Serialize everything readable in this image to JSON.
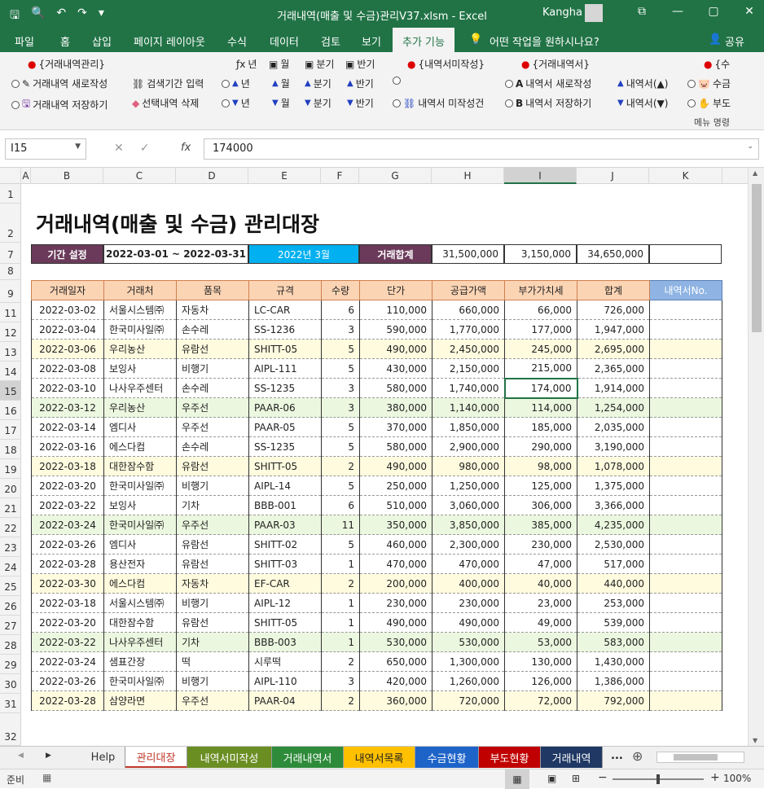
{
  "window": {
    "title": "거래내역(매출 및 수금)관리V37.xlsm  -  Excel",
    "user": "Kangha",
    "min_icon": "—",
    "restore_icon": "▢",
    "close_icon": "✕",
    "ribbon_display_icon": "⧉"
  },
  "menu": {
    "tabs": [
      "파일",
      "홈",
      "삽입",
      "페이지 레이아웃",
      "수식",
      "데이터",
      "검토",
      "보기",
      "추가 기능"
    ],
    "active_tab": "추가 기능",
    "tell_me": "어떤 작업을 원하시나요?",
    "share": "공유"
  },
  "ribbon": {
    "g1_header": "{거래내역관리}",
    "new_entry": "거래내역 새로작성",
    "save_entry": "거래내역 저장하기",
    "search_period": "검색기간 입력",
    "delete_sel": "선택내역 삭제",
    "year": "년",
    "month": "월",
    "quarter": "분기",
    "half": "반기",
    "g2_header": "{내역서미작성}",
    "unwritten_cond": "내역서 미작성건",
    "g3_header": "{거래내역서}",
    "stmt_new": "내역서 새로작성",
    "stmt_save": "내역서 저장하기",
    "stmt_up": "내역서(▲)",
    "stmt_down": "내역서(▼)",
    "g4_header": "{수",
    "g4_item1": "수금",
    "g4_item2": "부도",
    "caption": "메뉴 명령"
  },
  "formula": {
    "cell_ref": "I15",
    "value": "174000",
    "fx": "fx"
  },
  "columns": [
    "A",
    "B",
    "C",
    "D",
    "E",
    "F",
    "G",
    "H",
    "I",
    "J",
    "K"
  ],
  "rows": [
    "1",
    "2",
    "7",
    "8",
    "9",
    "11",
    "12",
    "13",
    "14",
    "15",
    "16",
    "17",
    "18",
    "19",
    "20",
    "21",
    "22",
    "23",
    "24",
    "25",
    "26",
    "27",
    "28",
    "29",
    "30",
    "31",
    "32"
  ],
  "sheet": {
    "title": "거래내역(매출 및 수금) 관리대장",
    "period_label": "기간 설정",
    "period_range": "2022-03-01 ~ 2022-03-31",
    "month_label": "2022년 3월",
    "total_label": "거래합계",
    "total_supply": "31,500,000",
    "total_vat": "3,150,000",
    "total_sum": "34,650,000",
    "headers": [
      "거래일자",
      "거래처",
      "품목",
      "규격",
      "수량",
      "단가",
      "공급가액",
      "부가가치세",
      "합계",
      "내역서No."
    ],
    "rows": [
      [
        "2022-03-02",
        "서울시스템㈜",
        "자동차",
        "LC-CAR",
        "6",
        "110,000",
        "660,000",
        "66,000",
        "726,000",
        ""
      ],
      [
        "2022-03-04",
        "한국미사일㈜",
        "손수레",
        "SS-1236",
        "3",
        "590,000",
        "1,770,000",
        "177,000",
        "1,947,000",
        ""
      ],
      [
        "2022-03-06",
        "우리농산",
        "유람선",
        "SHITT-05",
        "5",
        "490,000",
        "2,450,000",
        "245,000",
        "2,695,000",
        ""
      ],
      [
        "2022-03-08",
        "보잉사",
        "비행기",
        "AIPL-111",
        "5",
        "430,000",
        "2,150,000",
        "215,000",
        "2,365,000",
        ""
      ],
      [
        "2022-03-10",
        "나사우주센터",
        "손수레",
        "SS-1235",
        "3",
        "580,000",
        "1,740,000",
        "174,000",
        "1,914,000",
        ""
      ],
      [
        "2022-03-12",
        "우리농산",
        "우주선",
        "PAAR-06",
        "3",
        "380,000",
        "1,140,000",
        "114,000",
        "1,254,000",
        ""
      ],
      [
        "2022-03-14",
        "엠디사",
        "우주선",
        "PAAR-05",
        "5",
        "370,000",
        "1,850,000",
        "185,000",
        "2,035,000",
        ""
      ],
      [
        "2022-03-16",
        "에스다컴",
        "손수레",
        "SS-1235",
        "5",
        "580,000",
        "2,900,000",
        "290,000",
        "3,190,000",
        ""
      ],
      [
        "2022-03-18",
        "대한잠수함",
        "유람선",
        "SHITT-05",
        "2",
        "490,000",
        "980,000",
        "98,000",
        "1,078,000",
        ""
      ],
      [
        "2022-03-20",
        "한국미사일㈜",
        "비행기",
        "AIPL-14",
        "5",
        "250,000",
        "1,250,000",
        "125,000",
        "1,375,000",
        ""
      ],
      [
        "2022-03-22",
        "보잉사",
        "기차",
        "BBB-001",
        "6",
        "510,000",
        "3,060,000",
        "306,000",
        "3,366,000",
        ""
      ],
      [
        "2022-03-24",
        "한국미사일㈜",
        "우주선",
        "PAAR-03",
        "11",
        "350,000",
        "3,850,000",
        "385,000",
        "4,235,000",
        ""
      ],
      [
        "2022-03-26",
        "엠디사",
        "유람선",
        "SHITT-02",
        "5",
        "460,000",
        "2,300,000",
        "230,000",
        "2,530,000",
        ""
      ],
      [
        "2022-03-28",
        "용산전자",
        "유람선",
        "SHITT-03",
        "1",
        "470,000",
        "470,000",
        "47,000",
        "517,000",
        ""
      ],
      [
        "2022-03-30",
        "에스다컴",
        "자동차",
        "EF-CAR",
        "2",
        "200,000",
        "400,000",
        "40,000",
        "440,000",
        ""
      ],
      [
        "2022-03-18",
        "서울시스템㈜",
        "비행기",
        "AIPL-12",
        "1",
        "230,000",
        "230,000",
        "23,000",
        "253,000",
        ""
      ],
      [
        "2022-03-20",
        "대한잠수함",
        "유람선",
        "SHITT-05",
        "1",
        "490,000",
        "490,000",
        "49,000",
        "539,000",
        ""
      ],
      [
        "2022-03-22",
        "나사우주센터",
        "기차",
        "BBB-003",
        "1",
        "530,000",
        "530,000",
        "53,000",
        "583,000",
        ""
      ],
      [
        "2022-03-24",
        "샘표간장",
        "떡",
        "시루떡",
        "2",
        "650,000",
        "1,300,000",
        "130,000",
        "1,430,000",
        ""
      ],
      [
        "2022-03-26",
        "한국미사일㈜",
        "비행기",
        "AIPL-110",
        "3",
        "420,000",
        "1,260,000",
        "126,000",
        "1,386,000",
        ""
      ],
      [
        "2022-03-28",
        "삼양라면",
        "우주선",
        "PAAR-04",
        "2",
        "360,000",
        "720,000",
        "72,000",
        "792,000",
        ""
      ]
    ]
  },
  "sheet_tabs": [
    {
      "label": "Help",
      "bg": "#f0f0f0",
      "fg": "#333333"
    },
    {
      "label": "관리대장",
      "bg": "#ffffff",
      "fg": "#c0392b"
    },
    {
      "label": "내역서미작성",
      "bg": "#6b8e23",
      "fg": "#ffffff"
    },
    {
      "label": "거래내역서",
      "bg": "#2e8b3a",
      "fg": "#ffffff"
    },
    {
      "label": "내역서목록",
      "bg": "#ffc000",
      "fg": "#222222"
    },
    {
      "label": "수금현황",
      "bg": "#1e64c8",
      "fg": "#ffffff"
    },
    {
      "label": "부도현황",
      "bg": "#c00000",
      "fg": "#ffffff"
    },
    {
      "label": "거래내역",
      "bg": "#1f3864",
      "fg": "#ffffff"
    }
  ],
  "more_tabs": "...",
  "status": {
    "ready": "준비",
    "zoom": "100%"
  }
}
